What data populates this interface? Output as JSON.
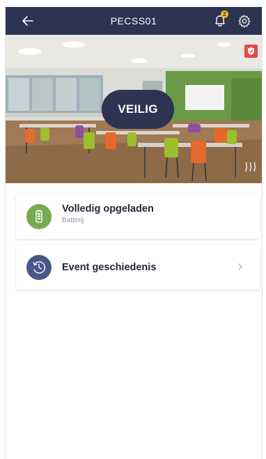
{
  "header": {
    "title": "PECSS01",
    "notification_count": "2"
  },
  "hero": {
    "status_label": "VEILIG"
  },
  "cards": [
    {
      "title": "Volledig opgeladen",
      "subtitle": "Batterij",
      "icon": "battery-icon",
      "icon_color": "#79a950"
    },
    {
      "title": "Event geschiedenis",
      "icon": "history-icon",
      "icon_color": "#4a5687"
    }
  ],
  "colors": {
    "header_bg": "#2c3452",
    "status_pill": "#2c3452",
    "alert_red": "#e34b4b",
    "badge": "#f2b824"
  }
}
